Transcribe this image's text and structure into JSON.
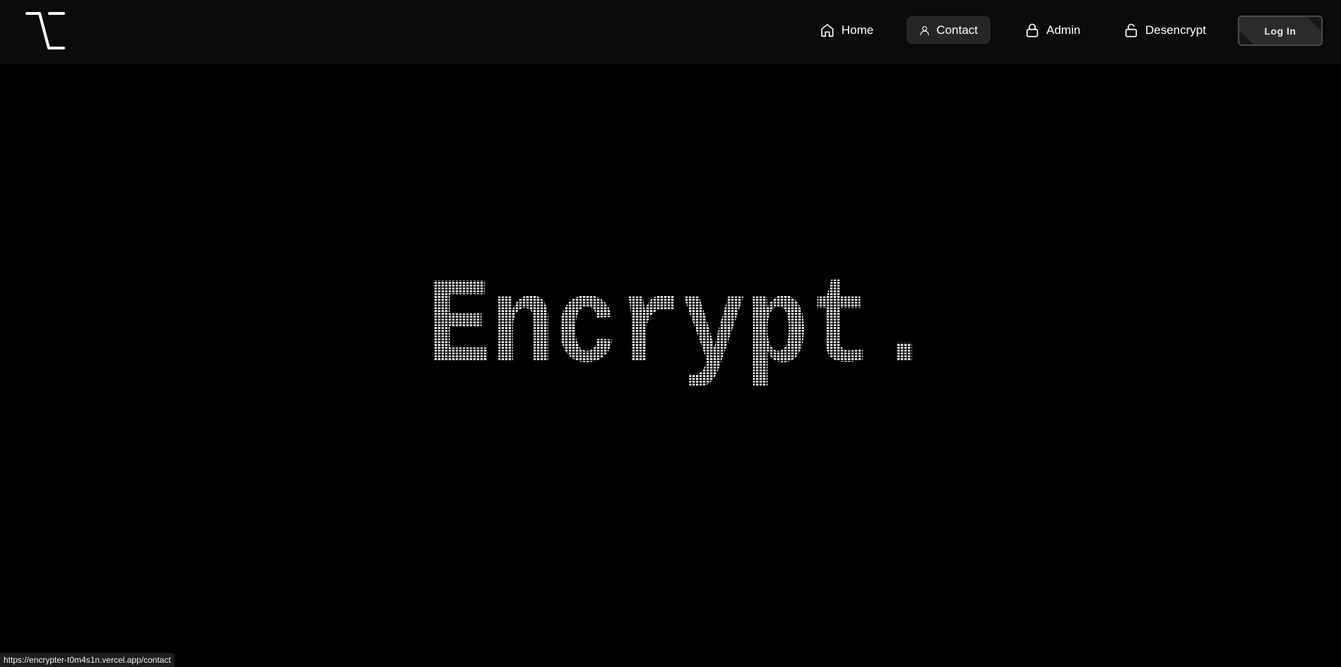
{
  "nav": {
    "logo_icon": "lambda-logo-icon",
    "items": [
      {
        "label": "Home",
        "icon": "home-icon",
        "active": false
      },
      {
        "label": "Contact",
        "icon": "user-icon",
        "active": true
      },
      {
        "label": "Admin",
        "icon": "lock-icon",
        "active": false
      },
      {
        "label": "Desencrypt",
        "icon": "unlock-icon",
        "active": false
      }
    ],
    "login_label": "Log In"
  },
  "hero": {
    "title": "Encrypt."
  },
  "status_bar": {
    "url": "https://encrypter-t0m4s1n.vercel.app/contact"
  },
  "colors": {
    "background": "#000000",
    "navbar": "#0b0b0b",
    "active_tab": "#262626",
    "text": "#ffffff",
    "login_button": "#2b2b2b"
  }
}
